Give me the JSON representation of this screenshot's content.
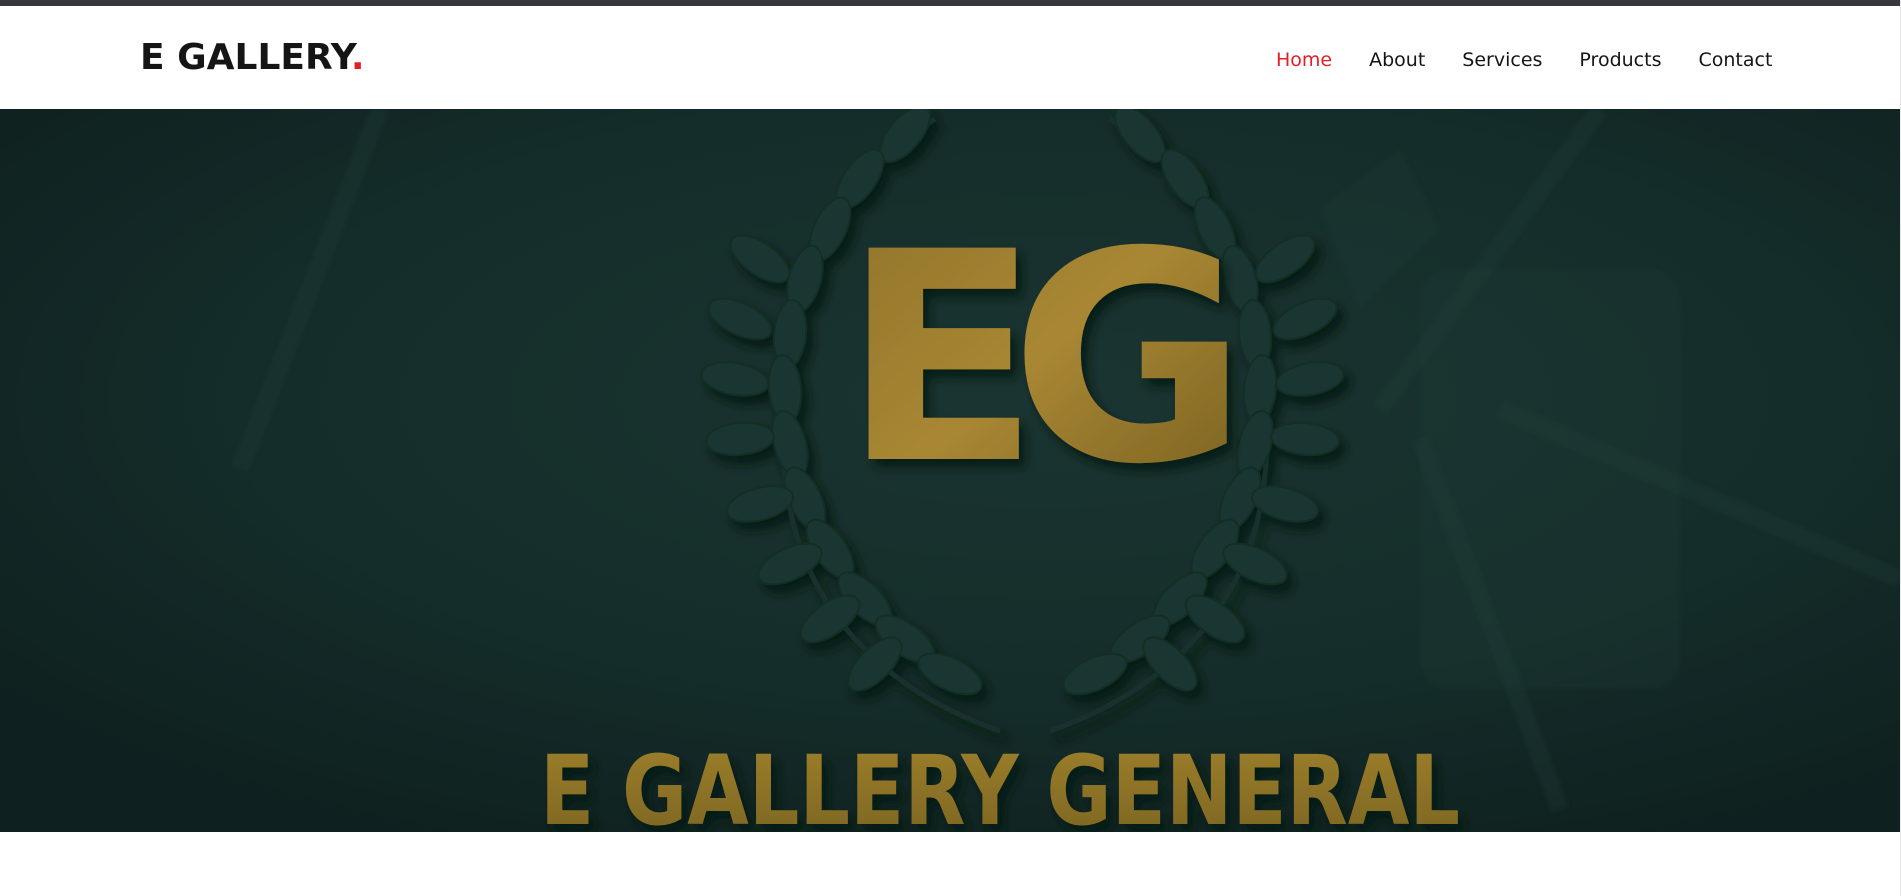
{
  "header": {
    "logo_text": "E GALLERY",
    "logo_dot": ".",
    "nav": [
      {
        "label": "Home",
        "active": true
      },
      {
        "label": "About",
        "active": false
      },
      {
        "label": "Services",
        "active": false
      },
      {
        "label": "Products",
        "active": false
      },
      {
        "label": "Contact",
        "active": false
      }
    ]
  },
  "hero": {
    "monogram": "EG",
    "company_name": "E GALLERY GENERAL"
  },
  "colors": {
    "accent": "#e21f26",
    "text": "#151515",
    "topbar": "#37373c",
    "hero_bg": "#142826",
    "gold": "#b8902e"
  }
}
